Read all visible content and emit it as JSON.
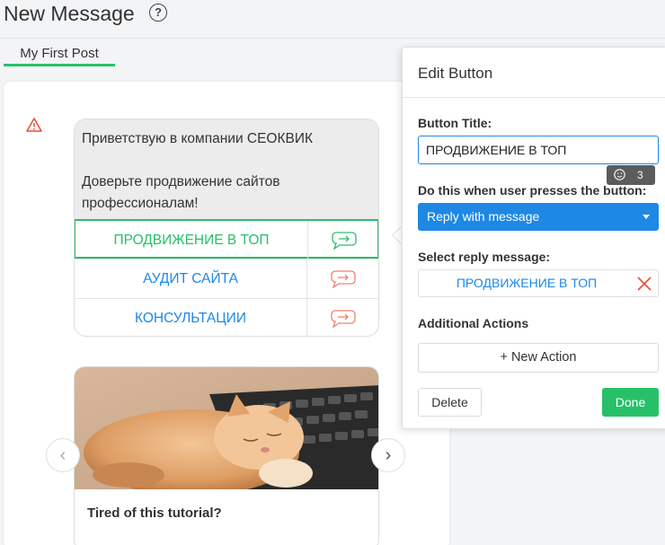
{
  "header": {
    "title": "New Message",
    "help_icon": "question-circle-icon"
  },
  "tabs": [
    {
      "label": "My First Post",
      "active": true
    }
  ],
  "message": {
    "text_line1": "Приветствую в компании СЕОКВИК",
    "text_line2": "Доверьте продвижение сайтов",
    "text_line3": "профессионалам!",
    "buttons": [
      {
        "label": "ПРОДВИЖЕНИЕ В ТОП",
        "selected": true
      },
      {
        "label": "АУДИТ САЙТА",
        "selected": false
      },
      {
        "label": "КОНСУЛЬТАЦИИ",
        "selected": false
      }
    ]
  },
  "gallery": {
    "card_title": "Tired of this tutorial?",
    "prev_glyph": "‹",
    "next_glyph": "›"
  },
  "edit_panel": {
    "title": "Edit Button",
    "button_title_label": "Button Title:",
    "button_title_value": "ПРОДВИЖЕНИЕ В ТОП",
    "emoji_count": "3",
    "action_label": "Do this when user presses the button:",
    "action_value": "Reply with message",
    "reply_label": "Select reply message:",
    "reply_value": "ПРОДВИЖЕНИЕ В ТОП",
    "additional_label": "Additional Actions",
    "new_action_label": "+ New Action",
    "delete_label": "Delete",
    "done_label": "Done"
  },
  "colors": {
    "accent_green": "#27c069",
    "accent_blue": "#1e88e5",
    "warning_red": "#e74c3c",
    "reply_icon_red": "#f08070"
  }
}
